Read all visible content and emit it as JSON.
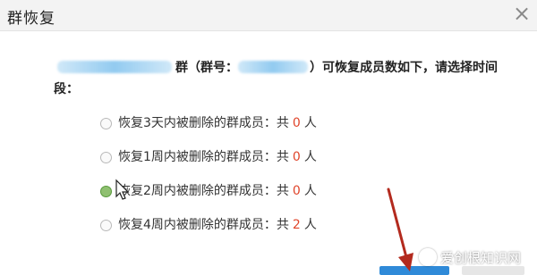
{
  "window": {
    "title": "群恢复",
    "close_glyph": "×"
  },
  "intro": {
    "part1": "群（群号：",
    "part2": "）可恢复成员数如下，请选择时间段："
  },
  "options": [
    {
      "prefix": "恢复3天内被删除的群成员：共",
      "count": "0",
      "unit": "人",
      "selected": false
    },
    {
      "prefix": "恢复1周内被删除的群成员：共",
      "count": "0",
      "unit": "人",
      "selected": false
    },
    {
      "prefix": "恢复2周内被删除的群成员：共",
      "count": "0",
      "unit": "人",
      "selected": true
    },
    {
      "prefix": "恢复4周内被删除的群成员：共",
      "count": "2",
      "unit": "人",
      "selected": false
    }
  ],
  "watermark": {
    "text": "爱创根知识网"
  },
  "colors": {
    "count_red": "#e0452b",
    "annotation_arrow": "#b32a1e",
    "confirm_blue": "#2f8ad8"
  }
}
